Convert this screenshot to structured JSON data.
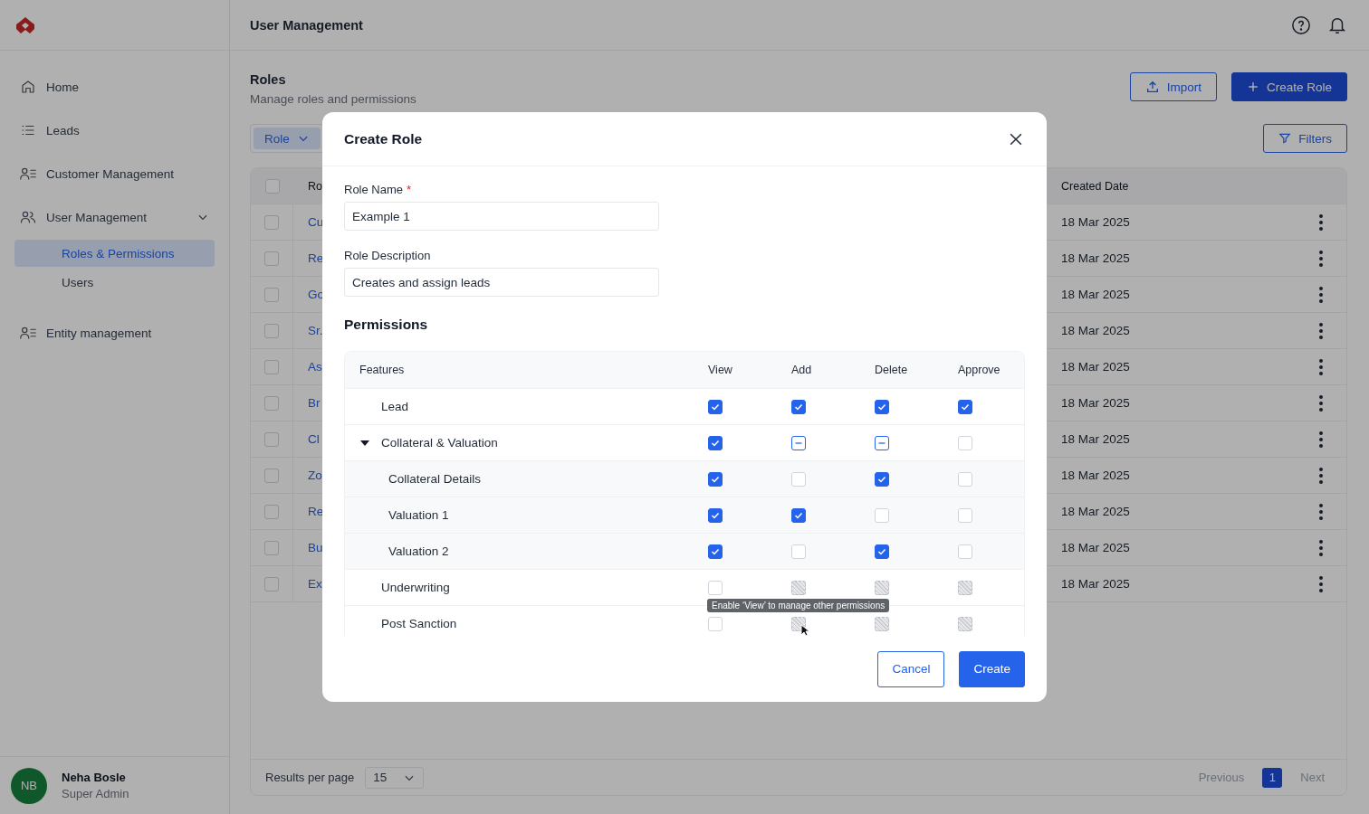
{
  "header": {
    "title": "User Management"
  },
  "sidebar": {
    "items": [
      {
        "label": "Home",
        "selected": false
      },
      {
        "label": "Leads",
        "selected": false
      },
      {
        "label": "Customer Management",
        "selected": false
      },
      {
        "label": "User Management",
        "selected": false,
        "expanded": true,
        "children": [
          {
            "label": "Roles & Permissions",
            "selected": true
          },
          {
            "label": "Users",
            "selected": false
          }
        ]
      },
      {
        "label": "Entity management",
        "selected": false
      }
    ],
    "user": {
      "initials": "NB",
      "name": "Neha Bosle",
      "role": "Super Admin"
    }
  },
  "page": {
    "title": "Roles",
    "subtitle": "Manage roles and permissions",
    "buttons": [
      {
        "label": "Import",
        "kind": "outline"
      },
      {
        "label": "Create Role",
        "kind": "primary"
      }
    ],
    "filter_chip": "Role",
    "filters_button": "Filters"
  },
  "table": {
    "columns": [
      "Ro",
      "Created Date"
    ],
    "select_all_checked": false,
    "rows": [
      {
        "role": "Cu",
        "created": "18 Mar 2025",
        "checked": false
      },
      {
        "role": "Re",
        "created": "18 Mar 2025",
        "checked": false
      },
      {
        "role": "Go",
        "created": "18 Mar 2025",
        "checked": false
      },
      {
        "role": "Sr.",
        "created": "18 Mar 2025",
        "checked": false
      },
      {
        "role": "As",
        "created": "18 Mar 2025",
        "checked": false
      },
      {
        "role": "Br",
        "created": "18 Mar 2025",
        "checked": false
      },
      {
        "role": "Cl",
        "created": "18 Mar 2025",
        "checked": false
      },
      {
        "role": "Zo",
        "created": "18 Mar 2025",
        "checked": false
      },
      {
        "role": "Re",
        "created": "18 Mar 2025",
        "checked": false
      },
      {
        "role": "Bu",
        "created": "18 Mar 2025",
        "checked": false
      },
      {
        "role": "Ex",
        "created": "18 Mar 2025",
        "checked": false
      }
    ]
  },
  "pagination": {
    "label": "Results per page",
    "per_page": "15",
    "previous": "Previous",
    "pages": [
      {
        "label": "1",
        "selected": true
      }
    ],
    "next": "Next"
  },
  "modal": {
    "title": "Create Role",
    "fields": [
      {
        "label": "Role Name",
        "required_mark": "*",
        "value": "Example 1"
      },
      {
        "label": "Role Description",
        "value": "Creates and assign leads"
      }
    ],
    "permissions_title": "Permissions",
    "columns": [
      "Features",
      "View",
      "Add",
      "Delete",
      "Approve"
    ],
    "rows": [
      {
        "label": "Lead",
        "kind": "item",
        "cells": [
          {
            "checked": true,
            "disabled": false
          },
          {
            "checked": true,
            "disabled": false
          },
          {
            "checked": true,
            "disabled": false
          },
          {
            "checked": true,
            "disabled": false
          }
        ]
      },
      {
        "label": "Collateral & Valuation",
        "kind": "group",
        "expanded": true,
        "cells": [
          {
            "checked": true,
            "disabled": false
          },
          {
            "indeterminate": true,
            "disabled": false
          },
          {
            "indeterminate": true,
            "disabled": false
          },
          {
            "checked": false,
            "disabled": false
          }
        ],
        "children": [
          {
            "label": "Collateral Details",
            "cells": [
              {
                "checked": true,
                "disabled": false
              },
              {
                "checked": false,
                "disabled": false
              },
              {
                "checked": true,
                "disabled": false
              },
              {
                "checked": false,
                "disabled": false
              }
            ]
          },
          {
            "label": "Valuation 1",
            "cells": [
              {
                "checked": true,
                "disabled": false
              },
              {
                "checked": true,
                "disabled": false
              },
              {
                "checked": false,
                "disabled": false
              },
              {
                "checked": false,
                "disabled": false
              }
            ]
          },
          {
            "label": "Valuation 2",
            "cells": [
              {
                "checked": true,
                "disabled": false
              },
              {
                "checked": false,
                "disabled": false
              },
              {
                "checked": true,
                "disabled": false
              },
              {
                "checked": false,
                "disabled": false
              }
            ]
          }
        ]
      },
      {
        "label": "Underwriting",
        "kind": "item",
        "cells": [
          {
            "checked": false,
            "disabled": false
          },
          {
            "checked": false,
            "disabled": true
          },
          {
            "checked": false,
            "disabled": true
          },
          {
            "checked": false,
            "disabled": true
          }
        ]
      },
      {
        "label": "Post Sanction",
        "kind": "item",
        "cells": [
          {
            "checked": false,
            "disabled": false
          },
          {
            "checked": false,
            "disabled": true
          },
          {
            "checked": false,
            "disabled": true
          },
          {
            "checked": false,
            "disabled": true
          }
        ]
      }
    ],
    "tooltip": "Enable ‘View’ to manage other permissions",
    "buttons": [
      {
        "label": "Cancel",
        "kind": "outline"
      },
      {
        "label": "Create",
        "kind": "primary"
      }
    ]
  }
}
